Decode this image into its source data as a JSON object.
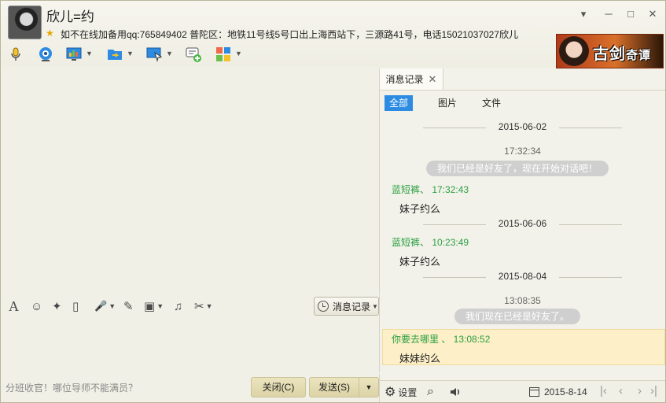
{
  "window": {
    "title": "欣儿=约",
    "status": "如不在线加备用qq:765849402  普陀区：地铁11号线5号口出上海西站下，三源路41号，电话15021037027欣儿",
    "controls": [
      "▾",
      "─",
      "□",
      "✕"
    ]
  },
  "ad": {
    "text_big": "古剑",
    "text_small": "奇谭"
  },
  "toolbar": {
    "icons": [
      "microphone-icon",
      "video-call-icon",
      "screen-share-icon",
      "file-transfer-icon",
      "remote-desktop-icon",
      "group-chat-icon",
      "apps-icon"
    ]
  },
  "format_bar": {
    "glyphs": {
      "font": "A",
      "emoji": "☺",
      "shake": "✦",
      "screenshot": "▯",
      "voice": "🎤",
      "edit": "✎",
      "image": "▣",
      "music": "♫",
      "scissors": "✂"
    },
    "history_button": "消息记录"
  },
  "bottom": {
    "tip": "分班收官！哪位导师不能满员？",
    "close_label": "关闭(C)",
    "send_label": "发送(S)"
  },
  "history": {
    "tab_label": "消息记录",
    "filters": [
      "全部",
      "图片",
      "文件"
    ],
    "entries": {
      "d1": "2015-06-02",
      "t1": "17:32:34",
      "s1": "我们已经是好友了，现在开始对话吧！",
      "m1_sender": "蓝短裤、 17:32:43",
      "m1_body": "妹子约么",
      "d2": "2015-06-06",
      "m2_sender": "蓝短裤、 10:23:49",
      "m2_body": "妹子约么",
      "d3": "2015-08-04",
      "t3": "13:08:35",
      "s3": "我们现在已经是好友了。",
      "m3_sender": "你要去哪里 、 13:08:52",
      "m3_body": "妹妹约么"
    },
    "footer": {
      "settings": "设置",
      "date": "2015-8-14"
    }
  },
  "colors": {
    "accent": "#2d8ce2",
    "sender": "#2aa042",
    "highlight": "#fdefc7"
  }
}
